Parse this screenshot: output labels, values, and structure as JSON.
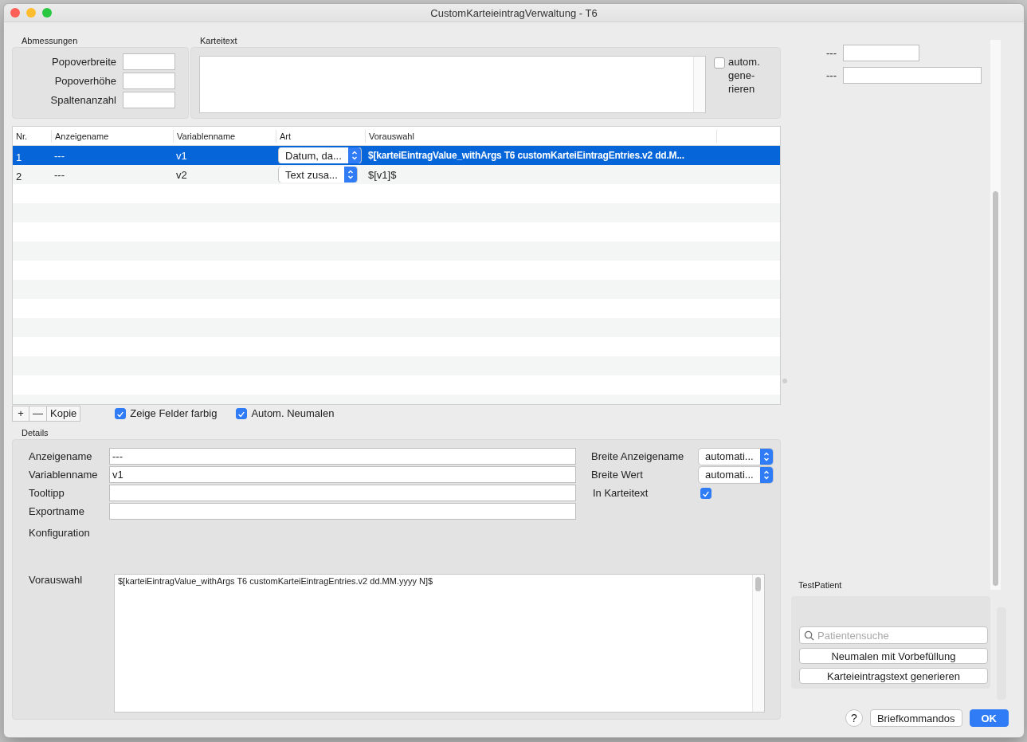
{
  "window": {
    "title": "CustomKarteieintragVerwaltung - T6"
  },
  "abmessungen": {
    "title": "Abmessungen",
    "fields": [
      {
        "label": "Popoverbreite"
      },
      {
        "label": "Popoverhöhe"
      },
      {
        "label": "Spaltenanzahl"
      }
    ]
  },
  "karteitext": {
    "title": "Karteitext",
    "auto_generate": {
      "label": "autom. gene-rieren",
      "checked": false
    }
  },
  "table": {
    "columns": [
      "Nr.",
      "Anzeigename",
      "Variablenname",
      "Art",
      "Vorauswahl"
    ],
    "rows": [
      {
        "nr": "1",
        "anzeigename": "---",
        "variablenname": "v1",
        "art": "Datum, da...",
        "vorauswahl": "$[karteiEintragValue_withArgs T6 customKarteiEintragEntries.v2 dd.M...",
        "selected": true
      },
      {
        "nr": "2",
        "anzeigename": "---",
        "variablenname": "v2",
        "art": "Text zusa...",
        "vorauswahl": "$[v1]$",
        "selected": false
      }
    ]
  },
  "table_toolbar": {
    "buttons": [
      "+",
      "—",
      "Kopie"
    ],
    "checkboxes": [
      {
        "label": "Zeige Felder farbig",
        "checked": true
      },
      {
        "label": "Autom. Neumalen",
        "checked": true
      }
    ]
  },
  "details": {
    "title": "Details",
    "fields": [
      {
        "label": "Anzeigename",
        "value": "---"
      },
      {
        "label": "Variablenname",
        "value": "v1"
      },
      {
        "label": "Tooltipp"
      },
      {
        "label": "Exportname"
      }
    ],
    "konfiguration": "Konfiguration",
    "popups": [
      {
        "label": "Breite Anzeigename",
        "value": "automati..."
      },
      {
        "label": "Breite Wert",
        "value": "automati..."
      }
    ],
    "in_karteitext": {
      "label": "In Karteitext",
      "checked": true
    },
    "vorauswahl": {
      "label": "Vorauswahl",
      "value": "$[karteiEintragValue_withArgs T6 customKarteiEintragEntries.v2 dd.MM.yyyy N]$"
    }
  },
  "preview": {
    "fields": [
      {
        "label": "---"
      },
      {
        "label": "---"
      }
    ]
  },
  "test_patient": {
    "title": "TestPatient",
    "search": {
      "placeholder": "Patientensuche"
    },
    "buttons": [
      "Neumalen mit Vorbefüllung",
      "Karteieintragstext generieren"
    ]
  },
  "footer": {
    "help": "?",
    "buttons": [
      {
        "label": "Briefkommandos",
        "kind": "normal"
      },
      {
        "label": "OK",
        "kind": "default"
      }
    ]
  }
}
